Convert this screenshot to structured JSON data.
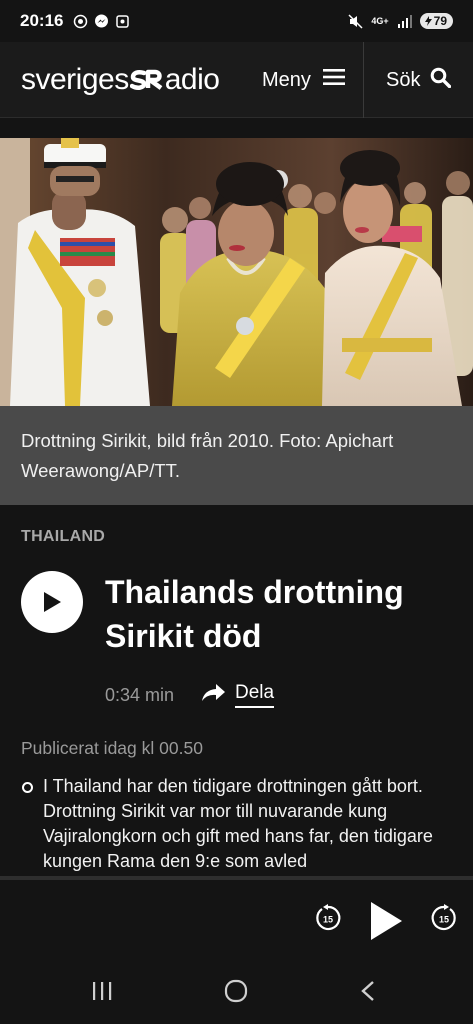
{
  "status_bar": {
    "time": "20:16",
    "network": "4G+",
    "battery": "79",
    "icons": [
      "whatsapp-icon",
      "messenger-icon",
      "screenshot-icon",
      "mute-icon",
      "signal-icon"
    ]
  },
  "header": {
    "logo_text_left": "sveriges",
    "logo_text_right": "adio",
    "menu_label": "Meny",
    "search_label": "Sök"
  },
  "hero": {
    "caption": "Drottning Sirikit, bild från 2010. Foto: Apichart Weerawong/AP/TT."
  },
  "article": {
    "category": "THAILAND",
    "headline": "Thailands drottning Sirikit död",
    "duration": "0:34 min",
    "share_label": "Dela",
    "published": "Publicerat idag kl 00.50",
    "body": "I Thailand har den tidigare drottningen gått bort. Drottning Sirikit var mor till nuvarande kung Vajiralongkorn och gift med hans far, den tidigare kungen Rama den 9:e som avled"
  },
  "player": {
    "rewind_seconds": "15",
    "forward_seconds": "15"
  },
  "colors": {
    "background": "#141414",
    "header": "#1b1b1b",
    "caption_bg": "#4a4a4a",
    "muted_text": "#9a9a9a"
  }
}
